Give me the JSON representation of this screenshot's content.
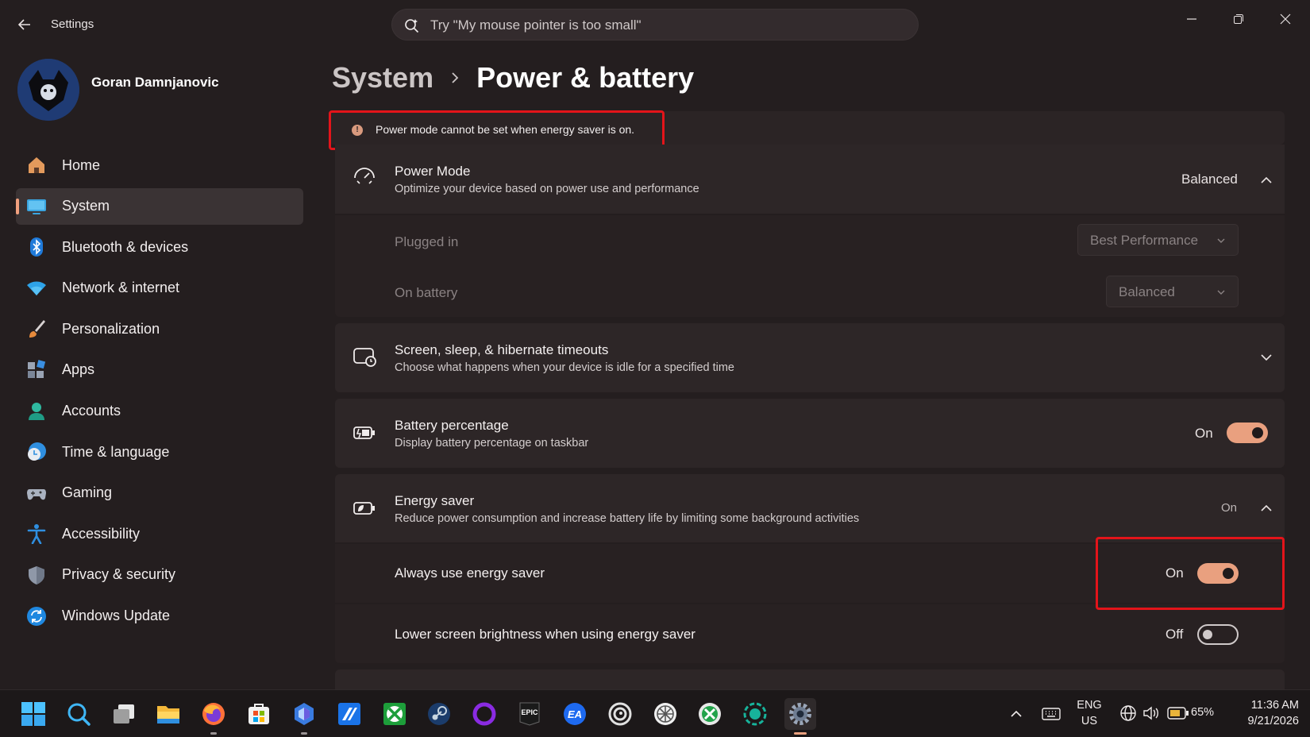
{
  "window": {
    "app_title": "Settings",
    "search_placeholder": "Try \"My mouse pointer is too small\""
  },
  "user": {
    "name": "Goran Damnjanovic"
  },
  "sidebar": {
    "items": [
      {
        "label": "Home",
        "icon": "home-icon"
      },
      {
        "label": "System",
        "icon": "system-icon",
        "active": true
      },
      {
        "label": "Bluetooth & devices",
        "icon": "bluetooth-icon"
      },
      {
        "label": "Network & internet",
        "icon": "wifi-icon"
      },
      {
        "label": "Personalization",
        "icon": "brush-icon"
      },
      {
        "label": "Apps",
        "icon": "apps-icon"
      },
      {
        "label": "Accounts",
        "icon": "accounts-icon"
      },
      {
        "label": "Time & language",
        "icon": "clock-globe-icon"
      },
      {
        "label": "Gaming",
        "icon": "gamepad-icon"
      },
      {
        "label": "Accessibility",
        "icon": "accessibility-icon"
      },
      {
        "label": "Privacy & security",
        "icon": "shield-icon"
      },
      {
        "label": "Windows Update",
        "icon": "update-icon"
      }
    ]
  },
  "breadcrumb": {
    "parent": "System",
    "current": "Power & battery"
  },
  "info_bar": {
    "text": "Power mode cannot be set when energy saver is on."
  },
  "power_mode": {
    "title": "Power Mode",
    "desc": "Optimize your device based on power use and performance",
    "value": "Balanced",
    "plugged_in": {
      "label": "Plugged in",
      "value": "Best Performance"
    },
    "on_battery": {
      "label": "On battery",
      "value": "Balanced"
    }
  },
  "timeouts": {
    "title": "Screen, sleep, & hibernate timeouts",
    "desc": "Choose what happens when your device is idle for a specified time"
  },
  "battery_percentage": {
    "title": "Battery percentage",
    "desc": "Display battery percentage on taskbar",
    "state": "On"
  },
  "energy_saver": {
    "title": "Energy saver",
    "desc": "Reduce power consumption and increase battery life by limiting some background activities",
    "state": "On",
    "always_use": {
      "label": "Always use energy saver",
      "state": "On"
    },
    "lower_brightness": {
      "label": "Lower screen brightness when using energy saver",
      "state": "Off"
    }
  },
  "taskbar": {
    "apps": [
      "start-icon",
      "search-icon",
      "task-view-icon",
      "file-explorer-icon",
      "firefox-icon",
      "microsoft-store-icon",
      "app-icon",
      "app-icon",
      "xbox-icon",
      "steam-icon",
      "circle-app-icon",
      "epic-games-icon",
      "ea-icon",
      "ubisoft-icon",
      "wheel-app-icon",
      "xbox-companion-icon",
      "app-icon",
      "settings-icon"
    ],
    "epic_label": "EPIC",
    "ea_label": "EA",
    "lang_top": "ENG",
    "lang_bottom": "US",
    "battery": "65%",
    "time": "11:36 AM",
    "date": "9/21/2026"
  },
  "colors": {
    "accent": "#e9a07f",
    "highlight": "#e3141a"
  }
}
